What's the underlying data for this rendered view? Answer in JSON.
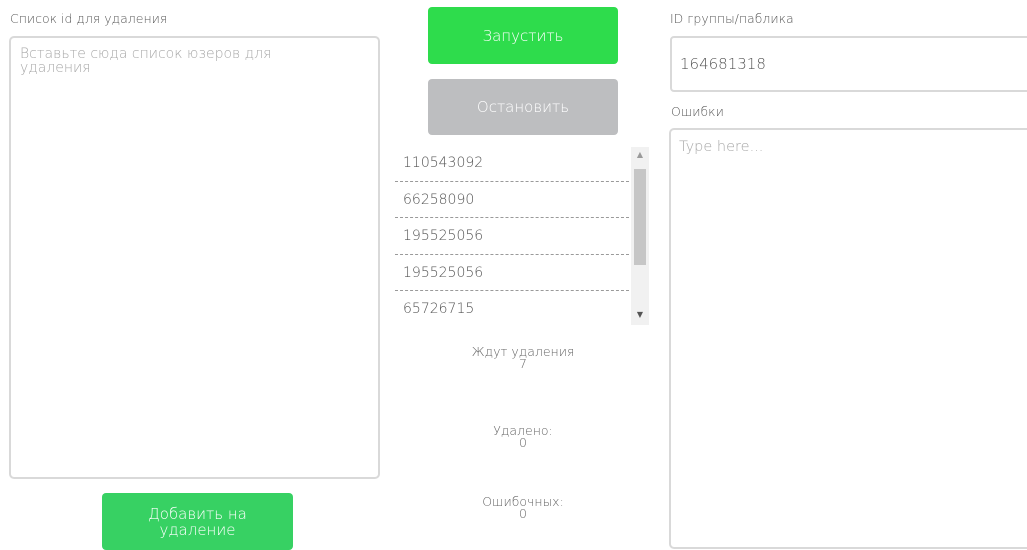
{
  "left_panel": {
    "label": "Список id для удаления",
    "placeholder": "Вставьте сюда список юзеров для удаления",
    "add_button": "Добавить на удаление"
  },
  "controls": {
    "start_button": "Запустить",
    "stop_button": "Остановить"
  },
  "queue": {
    "items": [
      "110543092",
      "66258090",
      "195525056",
      "195525056",
      "65726715"
    ]
  },
  "stats": {
    "pending_label": "Ждут удаления",
    "pending_value": "7",
    "deleted_label": "Удалено:",
    "deleted_value": "0",
    "errors_label": "Ошибочных:",
    "errors_value": "0"
  },
  "right_panel": {
    "group_label": "ID группы/паблика",
    "group_value": "164681318",
    "errors_label": "Ошибки",
    "errors_placeholder": "Type here..."
  },
  "colors": {
    "start": "#2edc4c",
    "add": "#37d163",
    "stop": "#bdbec0"
  }
}
